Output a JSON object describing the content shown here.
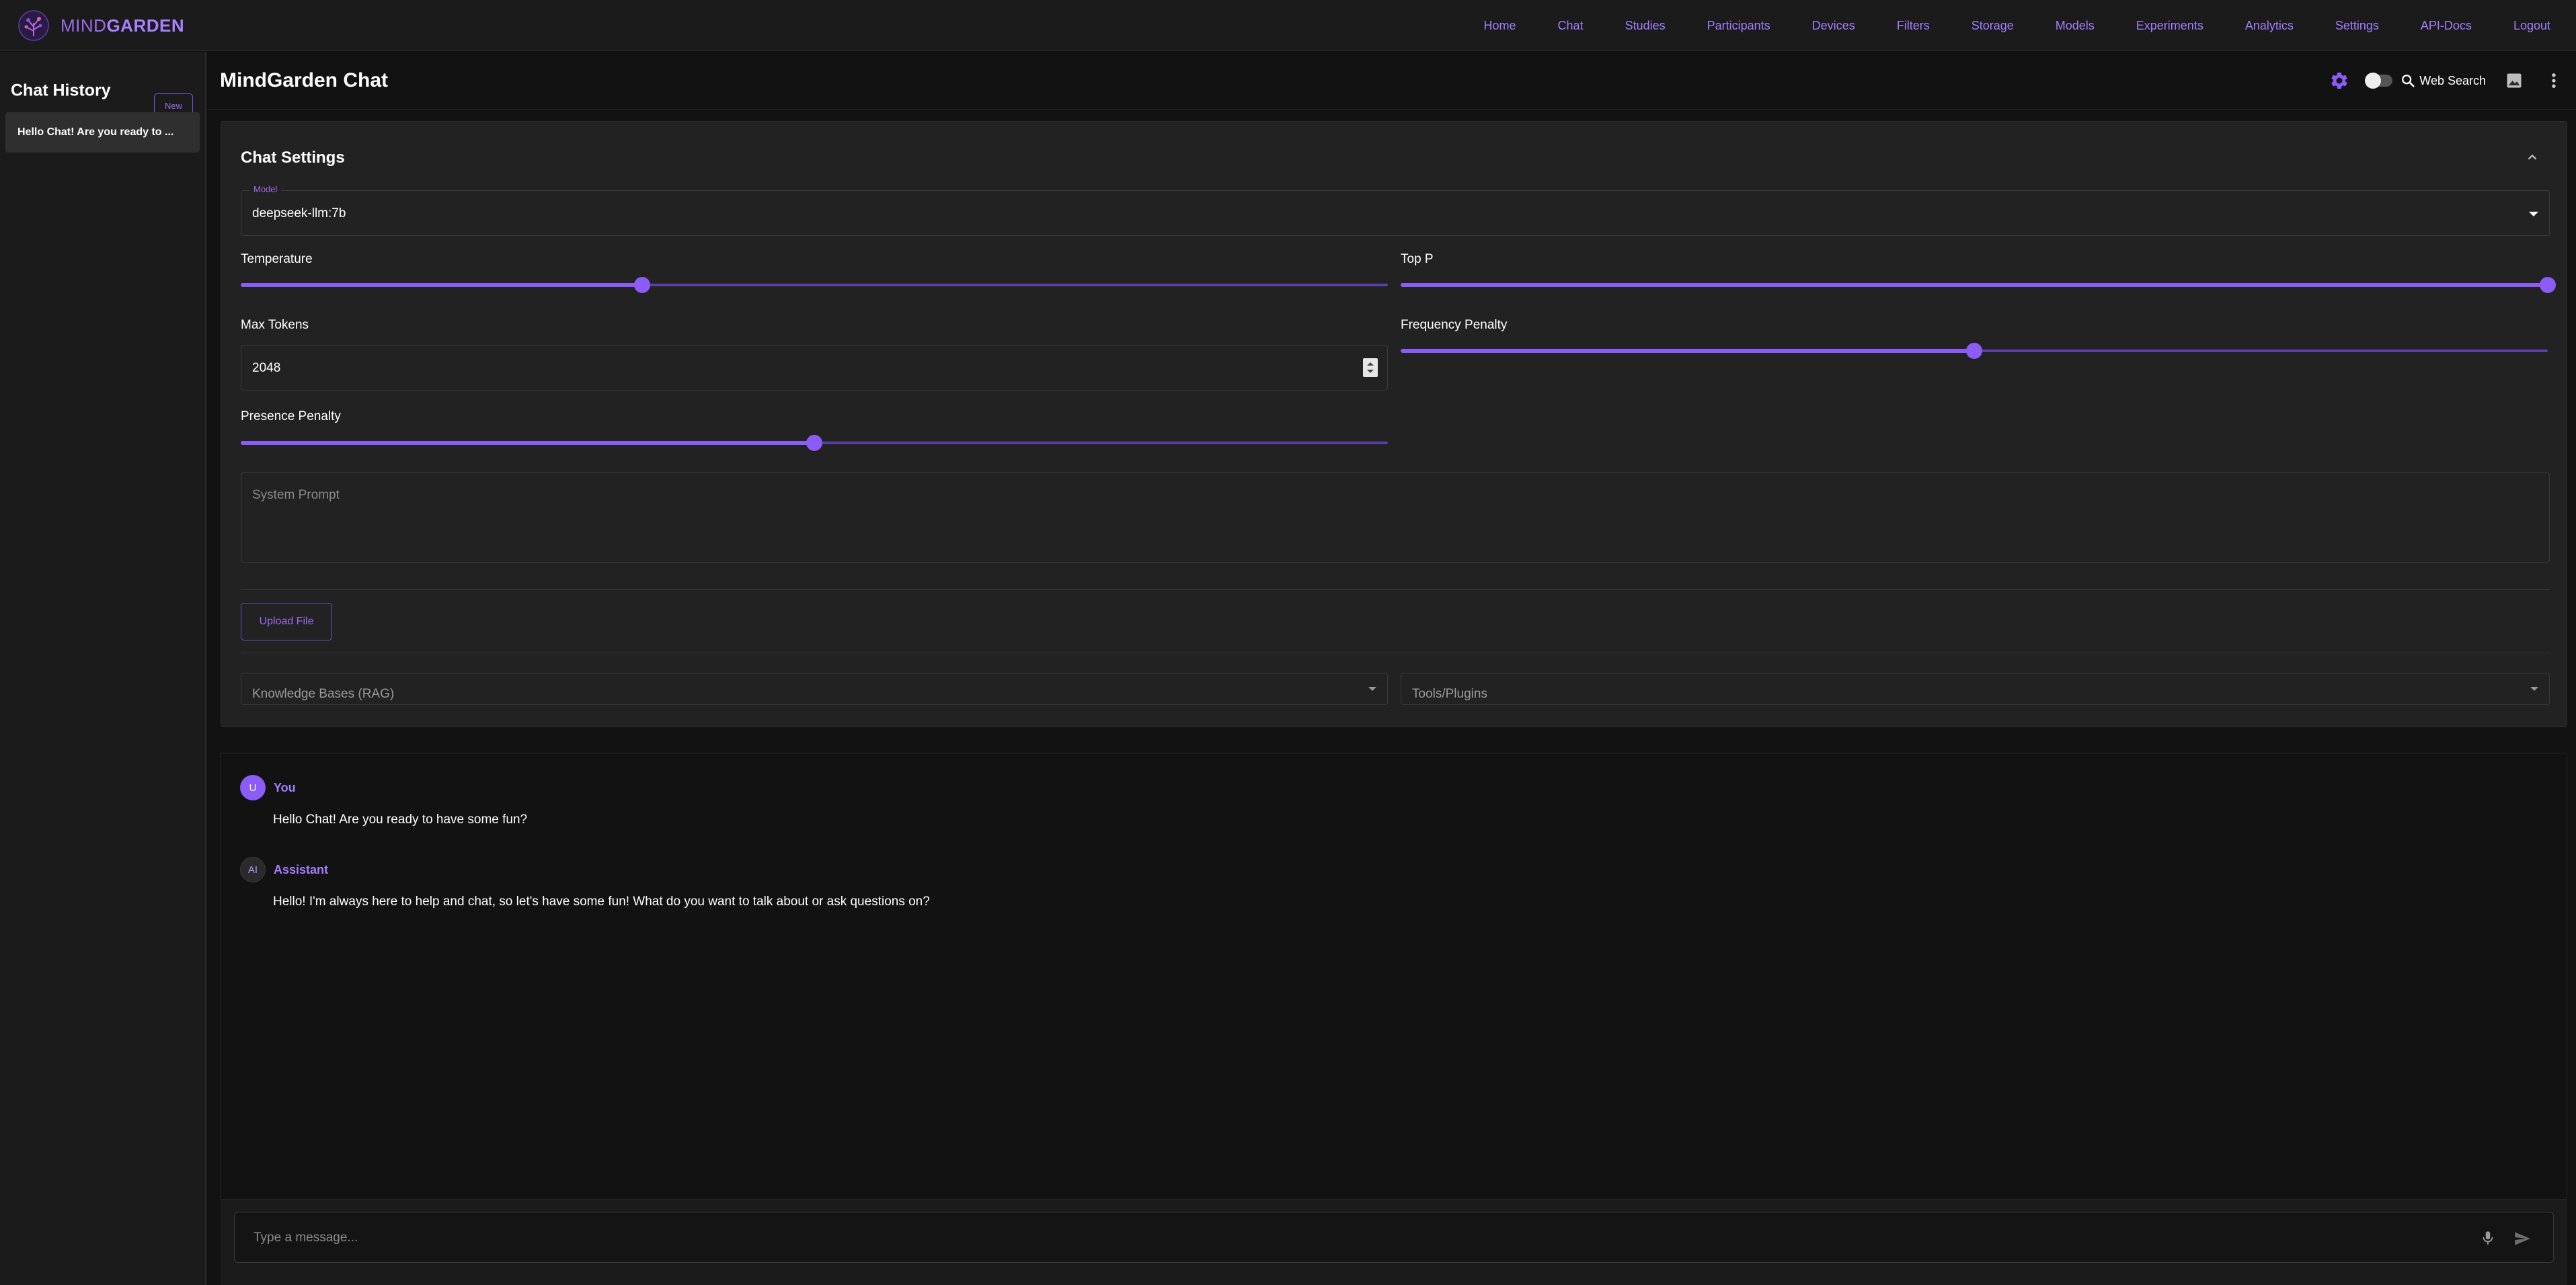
{
  "brand": {
    "name_part1": "MIND",
    "name_part2": "GARDEN"
  },
  "nav": [
    "Home",
    "Chat",
    "Studies",
    "Participants",
    "Devices",
    "Filters",
    "Storage",
    "Models",
    "Experiments",
    "Analytics",
    "Settings",
    "API-Docs",
    "Logout"
  ],
  "sidebar": {
    "title": "Chat History",
    "new_label": "New",
    "items": [
      {
        "label": "Hello Chat! Are you ready to ..."
      }
    ]
  },
  "header": {
    "title": "MindGarden Chat",
    "web_search_label": "Web Search"
  },
  "settings": {
    "title": "Chat Settings",
    "model": {
      "label": "Model",
      "value": "deepseek-llm:7b"
    },
    "temperature": {
      "label": "Temperature",
      "level": 0.35
    },
    "top_p": {
      "label": "Top P",
      "level": 1.0
    },
    "max_tokens": {
      "label": "Max Tokens",
      "value": "2048"
    },
    "frequency_penalty": {
      "label": "Frequency Penalty",
      "level": 0.5
    },
    "presence_penalty": {
      "label": "Presence Penalty",
      "level": 0.5
    },
    "system_prompt_placeholder": "System Prompt",
    "upload_label": "Upload File",
    "knowledge_placeholder": "Knowledge Bases (RAG)",
    "tools_placeholder": "Tools/Plugins"
  },
  "messages": [
    {
      "avatar": "U",
      "author": "You",
      "text": "Hello Chat! Are you ready to have some fun?"
    },
    {
      "avatar": "AI",
      "author": "Assistant",
      "text": "Hello! I'm always here to help and chat, so let's have some fun! What do you want to talk about or ask questions on?"
    }
  ],
  "input": {
    "placeholder": "Type a message..."
  },
  "colors": {
    "accent": "#8b5cf6",
    "background": "#121212",
    "panel": "#222222"
  },
  "icons": [
    "logo-icon",
    "gear-icon",
    "search-icon",
    "image-icon",
    "more-vert-icon",
    "chevron-up-icon",
    "mic-icon",
    "send-icon"
  ]
}
